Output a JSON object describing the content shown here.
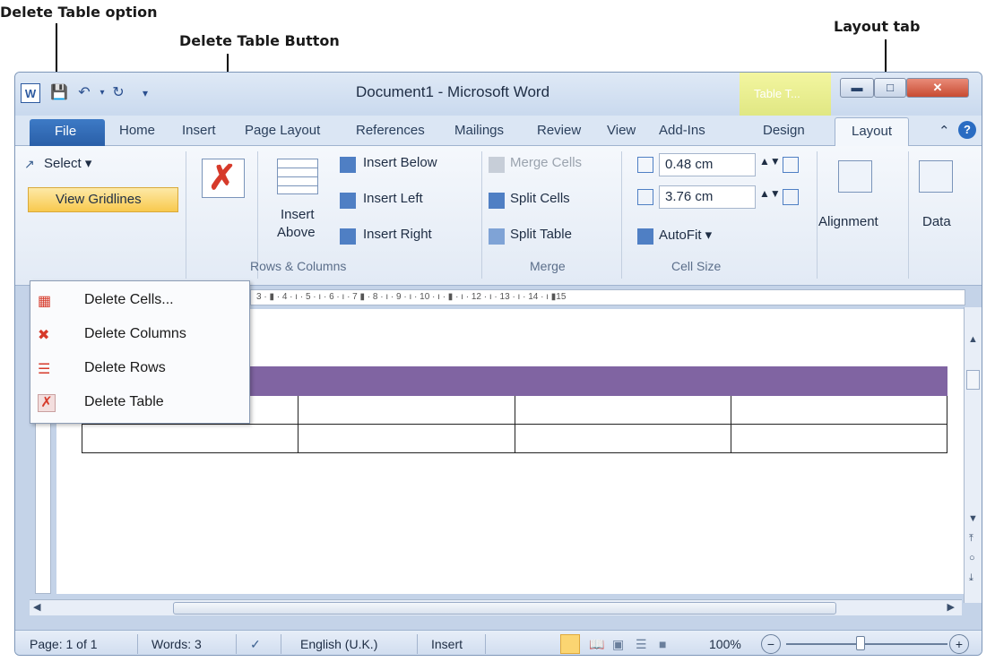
{
  "callouts": {
    "delete_table_option": "Delete Table option",
    "delete_table_button": "Delete Table Button",
    "layout_tab": "Layout tab"
  },
  "window": {
    "title": "Document1 - Microsoft Word",
    "contextual_group": "Table T...",
    "word_icon": "W"
  },
  "tabs": [
    "File",
    "Home",
    "Insert",
    "Page Layout",
    "References",
    "Mailings",
    "Review",
    "View",
    "Add-Ins",
    "Design",
    "Layout"
  ],
  "ribbon": {
    "select": "Select ▾",
    "view_gridlines": "View Gridlines",
    "insert_above": "Insert",
    "insert_above_2": "Above",
    "insert_below": "Insert Below",
    "insert_left": "Insert Left",
    "insert_right": "Insert Right",
    "rows_columns": "Rows & Columns",
    "merge_cells": "Merge Cells",
    "split_cells": "Split Cells",
    "split_table": "Split Table",
    "merge": "Merge",
    "height_value": "0.48 cm",
    "width_value": "3.76 cm",
    "autofit": "AutoFit ▾",
    "cell_size": "Cell Size",
    "alignment": "Alignment",
    "data": "Data"
  },
  "context_menu": [
    {
      "label": "Delete Cells...",
      "icon": "delete-cells-icon"
    },
    {
      "label": "Delete Columns",
      "icon": "delete-columns-icon"
    },
    {
      "label": "Delete Rows",
      "icon": "delete-rows-icon"
    },
    {
      "label": "Delete Table",
      "icon": "delete-table-icon"
    }
  ],
  "ruler": "3 · ▮ · 4 · ı · 5 · ı · 6 · ı · 7 ▮ · 8 · ı · 9 · ı · 10 · ı · ▮ · ı · 12 · ı · 13 · ı · 14 · ı ▮15",
  "status": {
    "page": "Page: 1 of 1",
    "words": "Words: 3",
    "language": "English (U.K.)",
    "mode": "Insert",
    "zoom": "100%"
  },
  "colors": {
    "table_header": "#8064a2",
    "file_tab": "#2a5fa8",
    "contextual_tab": "#e0e783"
  }
}
